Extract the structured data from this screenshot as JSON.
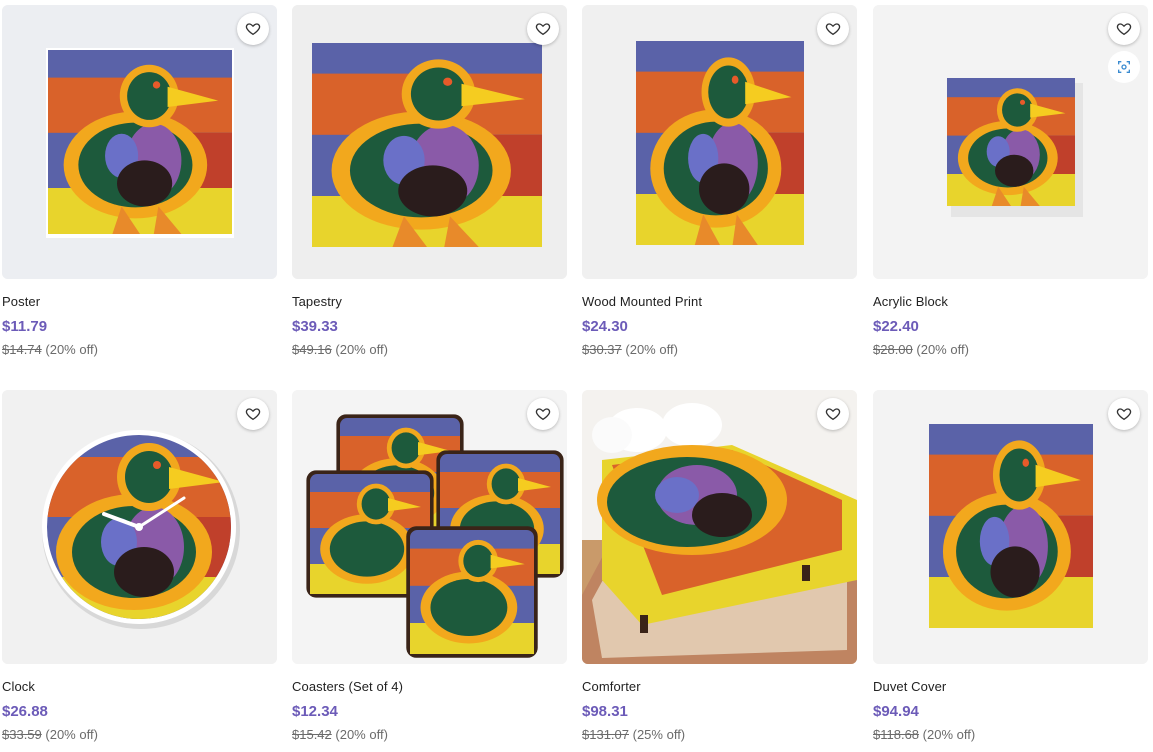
{
  "products": [
    {
      "title": "Poster",
      "price": "$11.79",
      "original_price": "$14.74",
      "discount": "(20% off)",
      "art": "duck-framed"
    },
    {
      "title": "Tapestry",
      "price": "$39.33",
      "original_price": "$49.16",
      "discount": "(20% off)",
      "art": "duck-fabric"
    },
    {
      "title": "Wood Mounted Print",
      "price": "$24.30",
      "original_price": "$30.37",
      "discount": "(20% off)",
      "art": "duck-framed"
    },
    {
      "title": "Acrylic Block",
      "price": "$22.40",
      "original_price": "$28.00",
      "discount": "(20% off)",
      "art": "duck-small-block"
    },
    {
      "title": "Clock",
      "price": "$26.88",
      "original_price": "$33.59",
      "discount": "(20% off)",
      "art": "duck-clock"
    },
    {
      "title": "Coasters (Set of 4)",
      "price": "$12.34",
      "original_price": "$15.42",
      "discount": "(20% off)",
      "art": "duck-coasters"
    },
    {
      "title": "Comforter",
      "price": "$98.31",
      "original_price": "$131.07",
      "discount": "(25% off)",
      "art": "duck-bed"
    },
    {
      "title": "Duvet Cover",
      "price": "$94.94",
      "original_price": "$118.68",
      "discount": "(20% off)",
      "art": "duck-fabric"
    }
  ],
  "icons": {
    "favorite": "heart-outline-icon",
    "view_in_room": "scan-icon"
  },
  "colors": {
    "price": "#6c5bb8",
    "original_price": "#6b6b6b",
    "thumb_bg": "#f2f2f2"
  }
}
